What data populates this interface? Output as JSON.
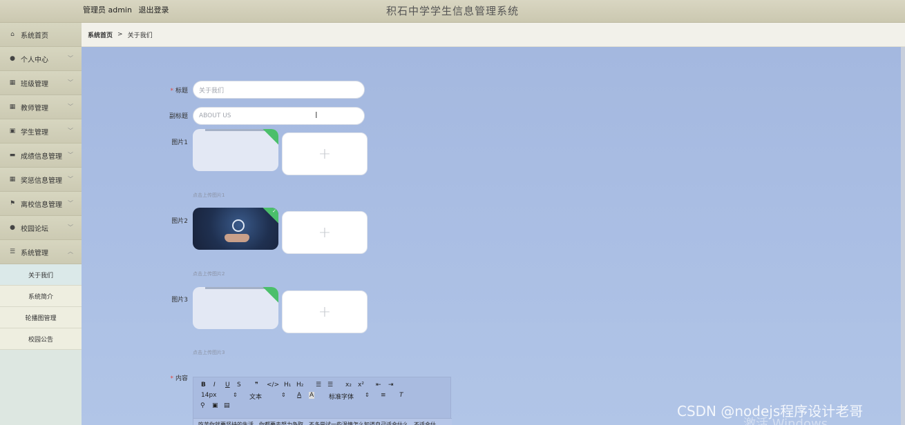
{
  "header": {
    "user_label": "管理员 admin",
    "logout": "退出登录",
    "title": "积石中学学生信息管理系统"
  },
  "sidebar": {
    "items": [
      {
        "label": "系统首页",
        "icon": "home-icon",
        "glyph": "⌂",
        "has_chevron": false
      },
      {
        "label": "个人中心",
        "icon": "person-icon",
        "glyph": "●",
        "has_chevron": true
      },
      {
        "label": "班级管理",
        "icon": "grid-icon",
        "glyph": "▦",
        "has_chevron": true
      },
      {
        "label": "教师管理",
        "icon": "grid-icon",
        "glyph": "▦",
        "has_chevron": true
      },
      {
        "label": "学生管理",
        "icon": "chart-icon",
        "glyph": "▣",
        "has_chevron": true
      },
      {
        "label": "成绩信息管理",
        "icon": "monitor-icon",
        "glyph": "▬",
        "has_chevron": true
      },
      {
        "label": "奖惩信息管理",
        "icon": "grid-icon",
        "glyph": "▦",
        "has_chevron": true
      },
      {
        "label": "离校信息管理",
        "icon": "flag-icon",
        "glyph": "⚑",
        "has_chevron": true
      },
      {
        "label": "校园论坛",
        "icon": "person-icon",
        "glyph": "●",
        "has_chevron": true
      },
      {
        "label": "系统管理",
        "icon": "sliders-icon",
        "glyph": "☰",
        "has_chevron": true,
        "expanded": true
      }
    ],
    "submenu": [
      "关于我们",
      "系统简介",
      "轮播图管理",
      "校园公告"
    ]
  },
  "breadcrumb": {
    "home": "系统首页",
    "separator": ">",
    "current": "关于我们"
  },
  "form": {
    "title_label": "标题",
    "title_value": "关于我们",
    "subtitle_label": "副标题",
    "subtitle_value": "ABOUT US",
    "image1_label": "图片1",
    "image1_hint": "点击上传图片1",
    "image2_label": "图片2",
    "image2_hint": "点击上传图片2",
    "image3_label": "图片3",
    "image3_hint": "点击上传图片3",
    "upload_plus": "+",
    "content_label": "内容",
    "required_mark": "*"
  },
  "editor": {
    "row1": [
      "B",
      "I",
      "U",
      "S",
      "❞",
      "</>",
      "H₁",
      "H₂",
      "☰",
      "☰",
      "x₂",
      "x²",
      "⇤",
      "⇥"
    ],
    "font_size": "14px",
    "text_style": "文本",
    "font_family": "标准字体",
    "content_text": "吃苦你就要坚持的生活，你都要去努力争取，不多尝试一些温情怎么知道自己适合什么，不适合什"
  },
  "watermark": {
    "csdn": "CSDN @nodejs程序设计老哥",
    "activate": "激活 Windows"
  }
}
